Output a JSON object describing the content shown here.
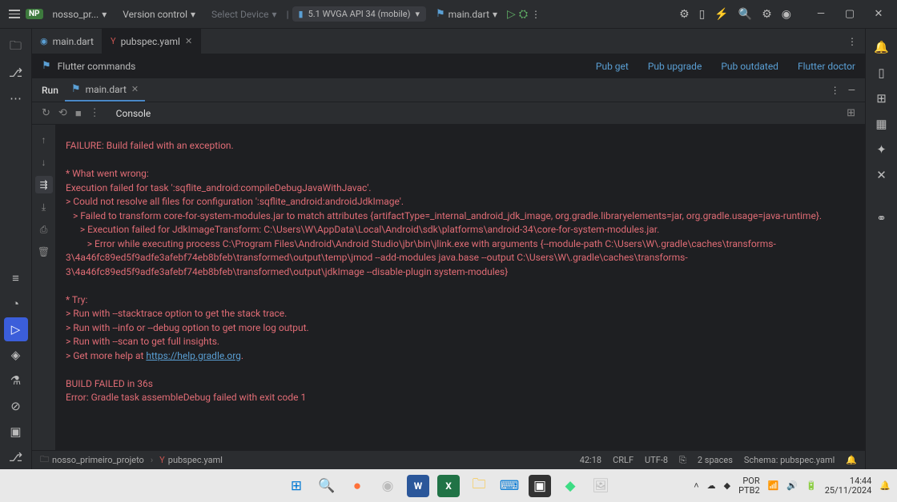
{
  "titlebar": {
    "project_badge": "NP",
    "project_name": "nosso_pr...",
    "vcs": "Version control",
    "select_device": "Select Device",
    "device": "5.1 WVGA API 34 (mobile)",
    "run_config": "main.dart"
  },
  "tabs": [
    {
      "icon": "dart",
      "label": "main.dart",
      "active": false,
      "closable": false
    },
    {
      "icon": "yaml",
      "label": "pubspec.yaml",
      "active": true,
      "closable": true
    }
  ],
  "flutter_bar": {
    "label": "Flutter commands",
    "links": [
      "Pub get",
      "Pub upgrade",
      "Pub outdated",
      "Flutter doctor"
    ]
  },
  "run_panel": {
    "title": "Run",
    "tab": "main.dart",
    "console_label": "Console"
  },
  "console_output": "FAILURE: Build failed with an exception.\n\n* What went wrong:\nExecution failed for task ':sqflite_android:compileDebugJavaWithJavac'.\n> Could not resolve all files for configuration ':sqflite_android:androidJdkImage'.\n   > Failed to transform core-for-system-modules.jar to match attributes {artifactType=_internal_android_jdk_image, org.gradle.libraryelements=jar, org.gradle.usage=java-runtime}.\n      > Execution failed for JdkImageTransform: C:\\Users\\W\\AppData\\Local\\Android\\sdk\\platforms\\android-34\\core-for-system-modules.jar.\n         > Error while executing process C:\\Program Files\\Android\\Android Studio\\jbr\\bin\\jlink.exe with arguments {--module-path C:\\Users\\W\\.gradle\\caches\\transforms-3\\4a46fc89ed5f9adfe3afebf74eb8bfeb\\transformed\\output\\temp\\jmod --add-modules java.base --output C:\\Users\\W\\.gradle\\caches\\transforms-3\\4a46fc89ed5f9adfe3afebf74eb8bfeb\\transformed\\output\\jdkImage --disable-plugin system-modules}\n\n* Try:\n> Run with --stacktrace option to get the stack trace.\n> Run with --info or --debug option to get more log output.\n> Run with --scan to get full insights.\n> Get more help at ",
  "console_link": "https://help.gradle.org",
  "console_output_tail": ".\n\nBUILD FAILED in 36s\nError: Gradle task assembleDebug failed with exit code 1",
  "statusbar": {
    "crumb1": "nosso_primeiro_projeto",
    "crumb2": "pubspec.yaml",
    "line_col": "42:18",
    "eol": "CRLF",
    "encoding": "UTF-8",
    "indent": "2 spaces",
    "schema": "Schema: pubspec.yaml"
  },
  "taskbar": {
    "lang": "POR\nPTB2",
    "time": "14:44",
    "date": "25/11/2024"
  }
}
